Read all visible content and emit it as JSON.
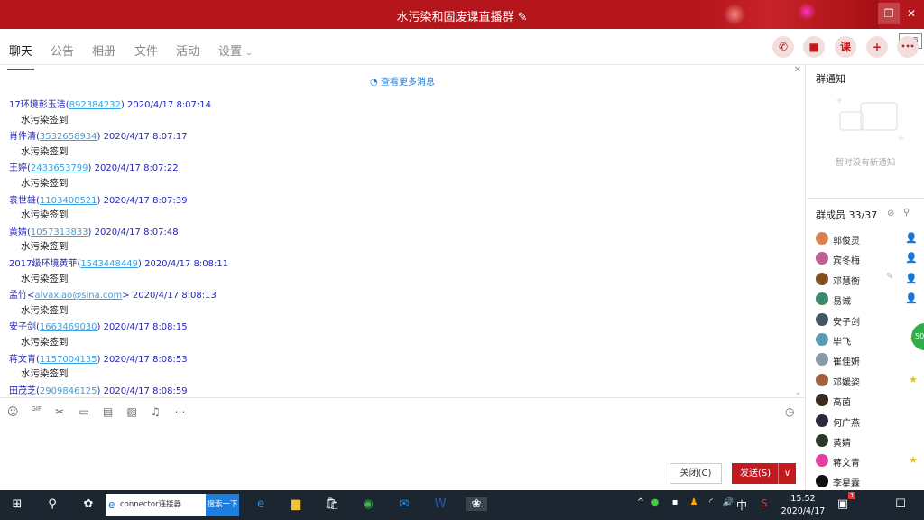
{
  "window": {
    "title": "水污染和固废课直播群",
    "edit_icon": "pencil-icon",
    "restore_tooltip": "还原",
    "restore_icon": "restore-icon",
    "close_icon": "close-icon"
  },
  "tabs": [
    {
      "label": "聊天",
      "active": true
    },
    {
      "label": "公告"
    },
    {
      "label": "相册"
    },
    {
      "label": "文件"
    },
    {
      "label": "活动"
    },
    {
      "label": "设置"
    }
  ],
  "toolbar_icons": [
    "phone-icon",
    "video-call-icon",
    "class-icon",
    "add-app-icon",
    "more-icon"
  ],
  "toolbar_glyphs": [
    "✆",
    "■",
    "课",
    "+",
    "•••"
  ],
  "chat": {
    "load_more": "查看更多消息",
    "messages": [
      {
        "name": "17环境彭玉洁",
        "id": "892384232",
        "open": "(",
        "close": ")",
        "time": "2020/4/17 8:07:14",
        "text": "水污染签到"
      },
      {
        "name": "肖件清",
        "id": "3532658934",
        "open": "(",
        "close": ")",
        "time": "2020/4/17 8:07:17",
        "text": "水污染签到"
      },
      {
        "name": "王婷",
        "id": "2433653799",
        "open": "(",
        "close": ")",
        "time": "2020/4/17 8:07:22",
        "text": "水污染签到"
      },
      {
        "name": "袁世雄",
        "id": "1103408521",
        "open": "(",
        "close": ")",
        "time": "2020/4/17 8:07:39",
        "text": "水污染签到"
      },
      {
        "name": "黄婧",
        "id": "1057313833",
        "open": "(",
        "close": ")",
        "time": "2020/4/17 8:07:48",
        "text": "水污染签到"
      },
      {
        "name": "2017级环境黄菲",
        "id": "1543448449",
        "open": "(",
        "close": ")",
        "time": "2020/4/17 8:08:11",
        "text": "水污染签到"
      },
      {
        "name": "孟竹",
        "id": "alvaxiao@sina.com",
        "open": "<",
        "close": ">",
        "time": "2020/4/17 8:08:13",
        "text": "水污染签到"
      },
      {
        "name": "安子剑",
        "id": "1663469030",
        "open": "(",
        "close": ")",
        "time": "2020/4/17 8:08:15",
        "text": "水污染签到"
      },
      {
        "name": "蒋文青",
        "id": "1157004135",
        "open": "(",
        "close": ")",
        "time": "2020/4/17 8:08:53",
        "text": "水污染签到"
      },
      {
        "name": "田茂芝",
        "id": "2909846125",
        "open": "(",
        "close": ")",
        "time": "2020/4/17 8:08:59",
        "text": ""
      }
    ]
  },
  "input": {
    "tools": [
      "emoji-icon",
      "gif-icon",
      "scissors-icon",
      "folder-icon",
      "doc-icon",
      "image-icon",
      "bell-icon",
      "more-icon"
    ],
    "tool_glyphs": [
      "☺",
      "GIF",
      "✂",
      "▭",
      "▤",
      "▨",
      "♫",
      "⋯"
    ],
    "close_label": "关闭(C)",
    "send_label": "发送(S)",
    "send_menu": "∨",
    "history_icon": "clock-icon"
  },
  "notice": {
    "title": "群通知",
    "empty": "暂时没有新通知"
  },
  "members": {
    "title": "群成员 33/37",
    "list": [
      {
        "name": "郭俊灵",
        "badge": "owner",
        "color": "#d98050"
      },
      {
        "name": "宾冬梅",
        "badge": "admin",
        "color": "#c06090"
      },
      {
        "name": "邓慧衡",
        "badge": "admin",
        "color": "#805020"
      },
      {
        "name": "易诚",
        "badge": "admin",
        "color": "#3a8a6a"
      },
      {
        "name": "安子剑",
        "badge": "",
        "color": "#445566"
      },
      {
        "name": "毕飞",
        "badge": "star",
        "color": "#5a9ab0"
      },
      {
        "name": "崔佳妍",
        "badge": "",
        "color": "#8899aa"
      },
      {
        "name": "邓媛姿",
        "badge": "star",
        "color": "#a06040"
      },
      {
        "name": "高茵",
        "badge": "",
        "color": "#3a2a20"
      },
      {
        "name": "何广燕",
        "badge": "",
        "color": "#2a2a3a"
      },
      {
        "name": "黄婧",
        "badge": "",
        "color": "#2a3a2a"
      },
      {
        "name": "蒋文青",
        "badge": "star",
        "color": "#e040a0"
      },
      {
        "name": "李星霖",
        "badge": "",
        "color": "#111"
      }
    ]
  },
  "taskbar": {
    "search_text": "connector连接器",
    "search_button": "搜索一下",
    "time": "15:52",
    "date": "2020/4/17",
    "ime": "中",
    "notification_count": "1",
    "floating_badge": "50"
  },
  "colors": {
    "brand": "#b5161b",
    "link": "#3aa0e0",
    "sender": "#2626b8"
  }
}
